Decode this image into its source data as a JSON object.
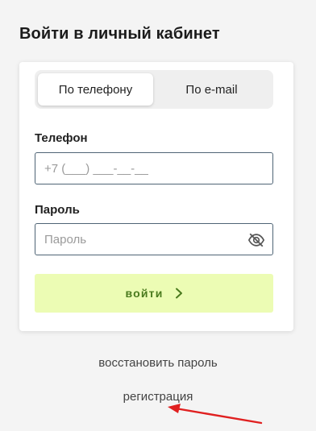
{
  "header": {
    "title": "Войти в личный кабинет"
  },
  "login_form": {
    "tabs": [
      {
        "label": "По телефону",
        "active": true
      },
      {
        "label": "По e-mail",
        "active": false
      }
    ],
    "phone": {
      "label": "Телефон",
      "placeholder": "+7 (___) ___-__-__"
    },
    "password": {
      "label": "Пароль",
      "placeholder": "Пароль",
      "visibility_icon": "eye-slash-icon"
    },
    "submit_label": "войти",
    "submit_icon": "chevron-right-icon"
  },
  "links": {
    "restore_password": "восстановить пароль",
    "register": "регистрация"
  },
  "annotation": {
    "arrow_color": "#e02020"
  },
  "colors": {
    "submit_bg": "#ecfcb4",
    "submit_text": "#4a7a1e",
    "input_border": "#4f6475"
  }
}
